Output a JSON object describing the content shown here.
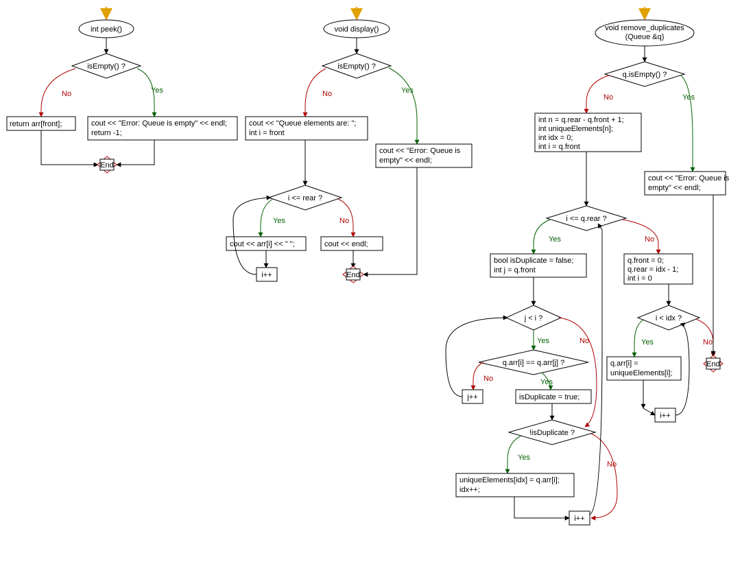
{
  "flowchart1": {
    "start": "int peek()",
    "d1": "isEmpty() ?",
    "yes": "Yes",
    "no": "No",
    "b_yes_l1": "cout << \"Error: Queue is empty\" << endl;",
    "b_yes_l2": "return -1;",
    "b_no": "return arr[front];",
    "end": "End"
  },
  "flowchart2": {
    "start": "void display()",
    "d1": "isEmpty() ?",
    "yes": "Yes",
    "no": "No",
    "b_no_l1": "cout << \"Queue elements are: \";",
    "b_no_l2": "int i = front",
    "b_yes_l1": "cout << \"Error: Queue is",
    "b_yes_l2": "empty\" << endl;",
    "d2": "i <= rear ?",
    "b_loop": "cout << arr[i] << \" \";",
    "inc": "i++",
    "b_after": "cout << endl;",
    "end": "End"
  },
  "flowchart3": {
    "start_l1": "void remove_duplicates",
    "start_l2": "(Queue &q)",
    "d1": "q.isEmpty() ?",
    "yes": "Yes",
    "no": "No",
    "b_init_l1": "int n = q.rear - q.front + 1;",
    "b_init_l2": "int uniqueElements[n];",
    "b_init_l3": "int idx = 0;",
    "b_init_l4": "int i = q.front",
    "b_err_l1": "cout << \"Error: Queue is",
    "b_err_l2": "empty\" << endl;",
    "d2": "i <= q.rear ?",
    "b_inner_l1": "bool isDuplicate = false;",
    "b_inner_l2": "int j = q.front",
    "d3": "j < i ?",
    "d4": "q.arr[i] == q.arr[j] ?",
    "jinc": "j++",
    "b_dup": "isDuplicate = true;",
    "d5": "!isDuplicate ?",
    "b_uniq_l1": "uniqueElements[idx] = q.arr[i];",
    "b_uniq_l2": "idx++;",
    "iinc": "i++",
    "b_after_l1": "q.front = 0;",
    "b_after_l2": "q.rear = idx - 1;",
    "b_after_l3": "int i = 0",
    "d6": "i < idx ?",
    "b_assign_l1": "q.arr[i] =",
    "b_assign_l2": "uniqueElements[i];",
    "iinc2": "i++",
    "end": "End"
  }
}
